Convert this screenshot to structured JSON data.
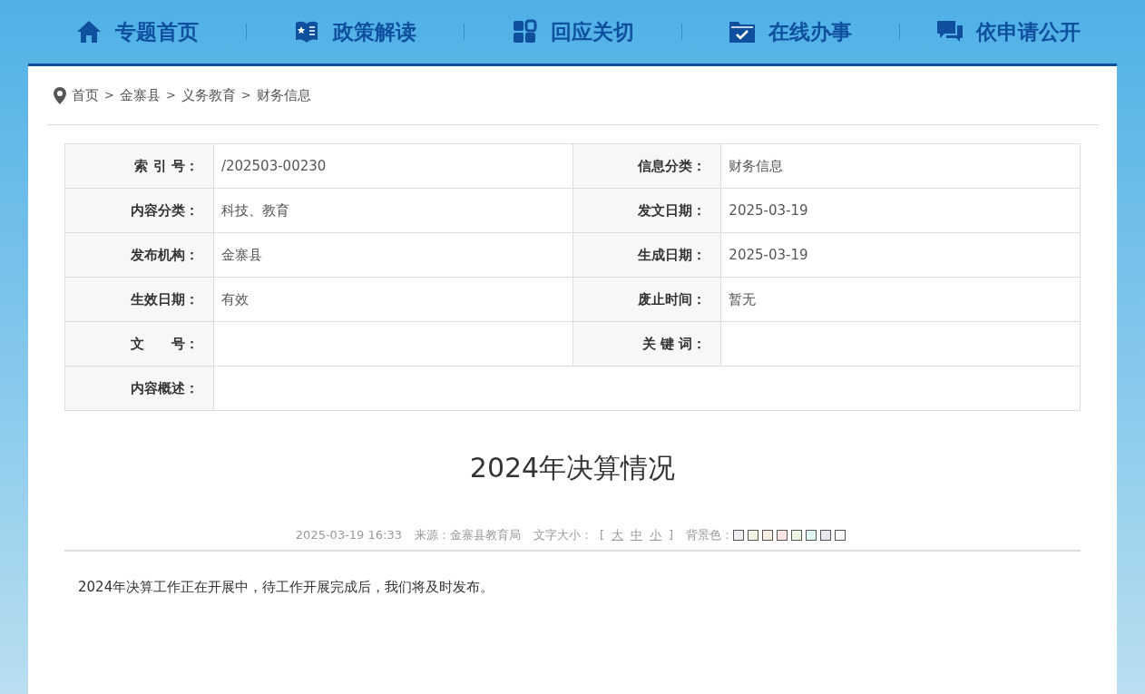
{
  "nav": [
    {
      "label": "专题首页",
      "kind": "home"
    },
    {
      "label": "政策解读",
      "kind": "book"
    },
    {
      "label": "回应关切",
      "kind": "grid"
    },
    {
      "label": "在线办事",
      "kind": "folder"
    },
    {
      "label": "依申请公开",
      "kind": "chat"
    }
  ],
  "breadcrumb": [
    "首页",
    "金寨县",
    "义务教育",
    "财务信息"
  ],
  "breadcrumb_separator": ">",
  "info_rows": [
    [
      {
        "label": "索 引 号：",
        "value": "/202503-00230"
      },
      {
        "label": "信息分类：",
        "value": "财务信息"
      }
    ],
    [
      {
        "label": "内容分类：",
        "value": "科技、教育"
      },
      {
        "label": "发文日期：",
        "value": "2025-03-19"
      }
    ],
    [
      {
        "label": "发布机构：",
        "value": "金寨县"
      },
      {
        "label": "生成日期：",
        "value": "2025-03-19"
      }
    ],
    [
      {
        "label": "生效日期：",
        "value": "有效"
      },
      {
        "label": "废止时间：",
        "value": "暂无"
      }
    ],
    [
      {
        "label": "文　　号："
      },
      {
        "label": "关 键 词："
      }
    ],
    [
      {
        "label": "内容概述："
      }
    ]
  ],
  "article": {
    "title": "2024年决算情况",
    "meta": {
      "datetime": "2025-03-19 16:33",
      "source": "来源：金寨县教育局",
      "font_size_label": "文字大小：",
      "bracket_open": "[",
      "font_sizes": [
        "大",
        "中",
        "小"
      ],
      "bracket_close": "]",
      "bg_label": "背景色：",
      "bg_colors": [
        {
          "color": "#eef1f4"
        },
        {
          "color": "#f3f7e4"
        },
        {
          "color": "#fcefe2"
        },
        {
          "color": "#fde4de"
        },
        {
          "color": "#eefbe2"
        },
        {
          "color": "#dff8f1"
        },
        {
          "color": "#e6e8f0"
        },
        {
          "color": "#ffffff"
        }
      ]
    },
    "body": "2024年决算工作正在开展中，待工作开展完成后，我们将及时发布。"
  }
}
